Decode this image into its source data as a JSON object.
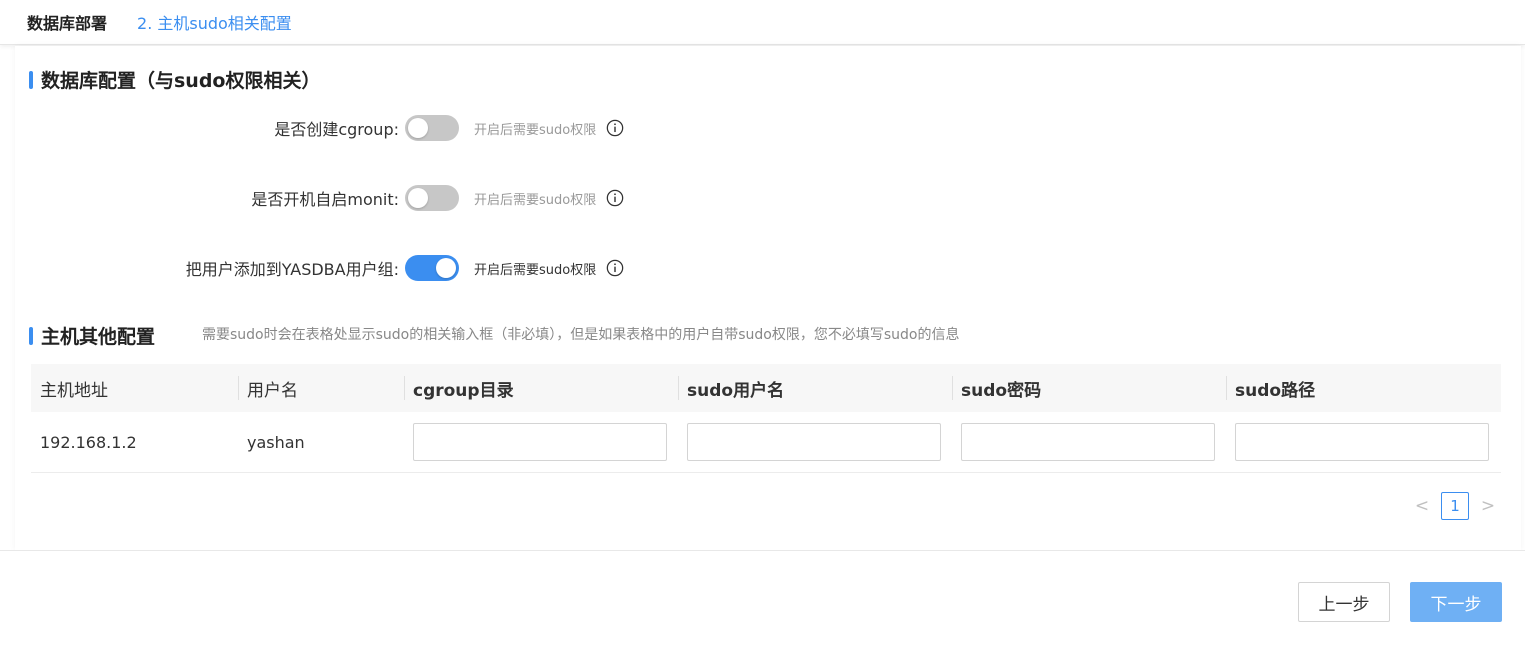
{
  "header": {
    "title": "数据库部署",
    "step": "2. 主机sudo相关配置"
  },
  "db_config": {
    "section_title": "数据库配置（与sudo权限相关）",
    "rows": [
      {
        "label": "是否创建cgroup:",
        "enabled": false,
        "hint": "开启后需要sudo权限"
      },
      {
        "label": "是否开机自启monit:",
        "enabled": false,
        "hint": "开启后需要sudo权限"
      },
      {
        "label": "把用户添加到YASDBA用户组:",
        "enabled": true,
        "hint": "开启后需要sudo权限"
      }
    ]
  },
  "host_config": {
    "section_title": "主机其他配置",
    "note": "需要sudo时会在表格处显示sudo的相关输入框（非必填），但是如果表格中的用户自带sudo权限，您不必填写sudo的信息",
    "columns": [
      "主机地址",
      "用户名",
      "cgroup目录",
      "sudo用户名",
      "sudo密码",
      "sudo路径"
    ],
    "rows": [
      {
        "host": "192.168.1.2",
        "user": "yashan",
        "cgroup_dir": "",
        "sudo_user": "",
        "sudo_password": "",
        "sudo_path": ""
      }
    ]
  },
  "pagination": {
    "prev": "<",
    "current": "1",
    "next": ">"
  },
  "footer": {
    "prev_label": "上一步",
    "next_label": "下一步"
  },
  "colors": {
    "accent": "#3b8ef0",
    "switch_off": "#c7c7c7",
    "next_button": "#6fb0f4"
  }
}
